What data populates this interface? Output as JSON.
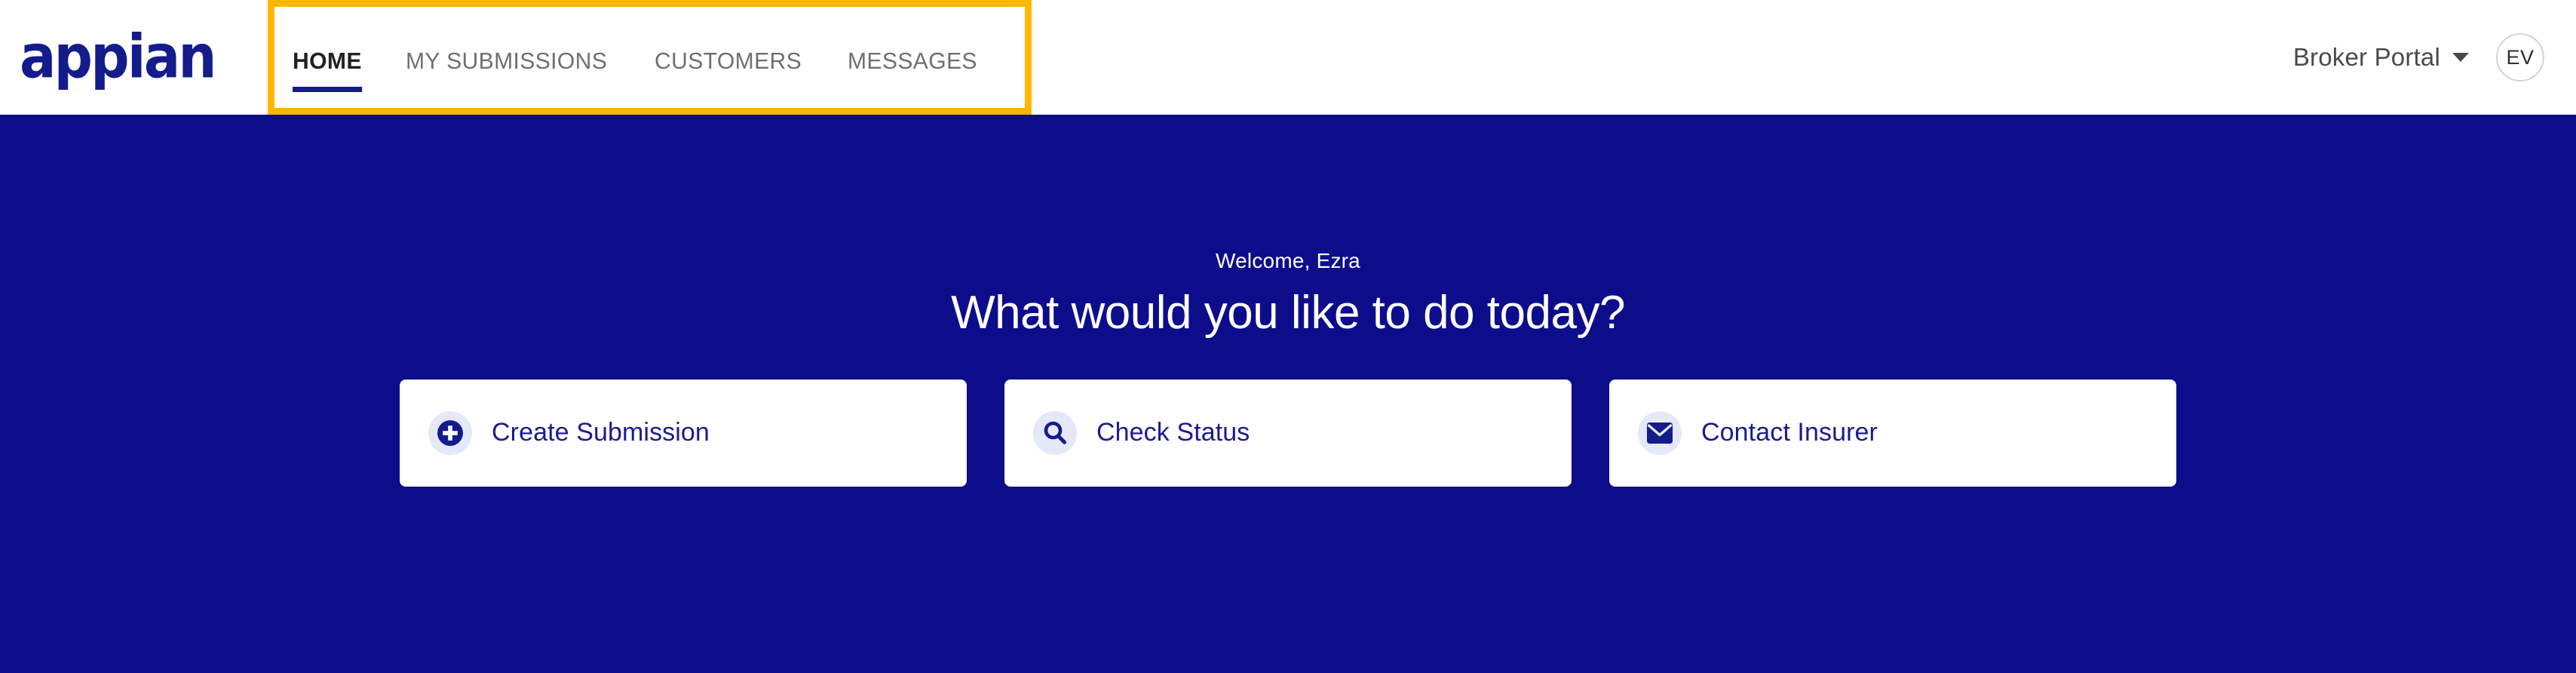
{
  "brand": {
    "logo_text": "appian",
    "logo_color": "#141C8C"
  },
  "header": {
    "nav_items": [
      {
        "label": "HOME",
        "active": true
      },
      {
        "label": "MY SUBMISSIONS",
        "active": false
      },
      {
        "label": "CUSTOMERS",
        "active": false
      },
      {
        "label": "MESSAGES",
        "active": false
      }
    ],
    "highlight_color": "#FFB600",
    "portal_selector": {
      "label": "Broker Portal",
      "icon": "chevron-down-icon"
    },
    "avatar": {
      "initials": "EV"
    }
  },
  "hero": {
    "background_color": "#0D0D8C",
    "welcome_text": "Welcome, Ezra",
    "headline": "What would you like to do today?",
    "cards": [
      {
        "label": "Create Submission",
        "icon": "plus-circle-icon",
        "icon_color": "#141C8C",
        "badge_color": "#E4E8F8"
      },
      {
        "label": "Check Status",
        "icon": "search-icon",
        "icon_color": "#141C8C",
        "badge_color": "#E4E8F8"
      },
      {
        "label": "Contact Insurer",
        "icon": "envelope-icon",
        "icon_color": "#141C8C",
        "badge_color": "#E4E8F8"
      }
    ]
  }
}
